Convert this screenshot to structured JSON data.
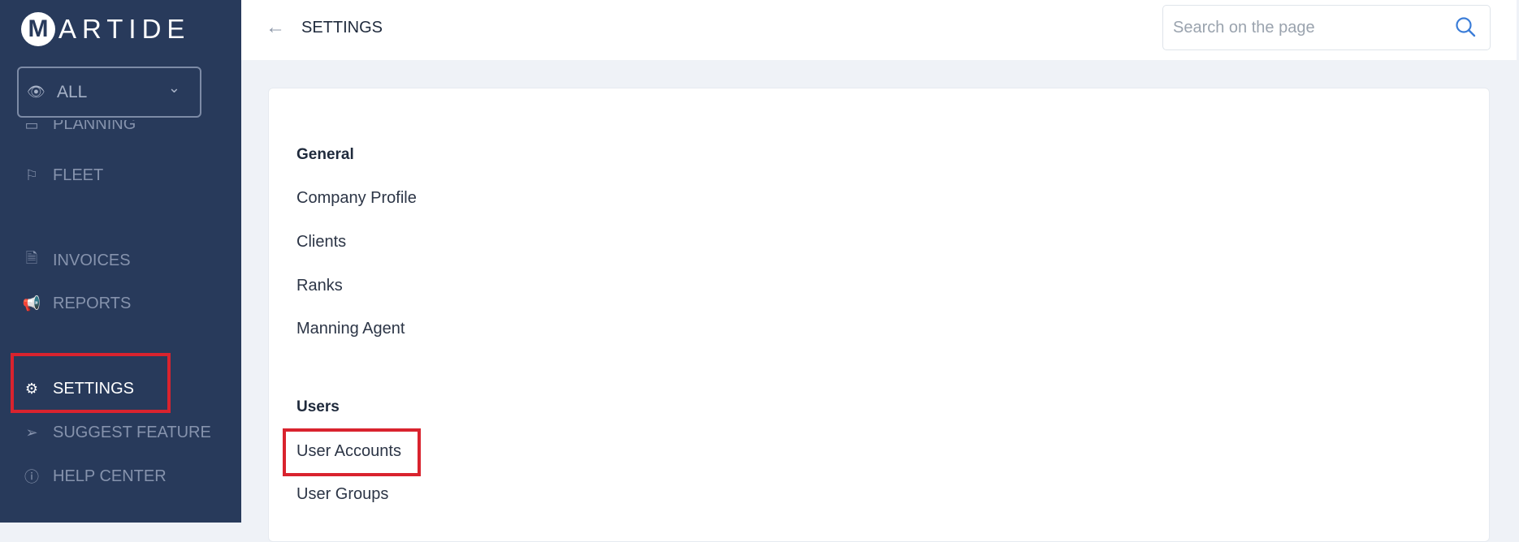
{
  "logo": {
    "mark": "M",
    "text": "ARTIDE"
  },
  "scope": {
    "value": "ALL",
    "icon": "eye-icon"
  },
  "sidebar": {
    "items": [
      {
        "label": "PLANNING",
        "icon": "calendar-icon"
      },
      {
        "label": "FLEET",
        "icon": "flag-icon"
      },
      {
        "label": "INVOICES",
        "icon": "document-icon"
      },
      {
        "label": "REPORTS",
        "icon": "megaphone-icon"
      },
      {
        "label": "SETTINGS",
        "icon": "gear-icon",
        "active": true
      },
      {
        "label": "SUGGEST FEATURE",
        "icon": "send-icon"
      },
      {
        "label": "HELP CENTER",
        "icon": "help-circle-icon"
      }
    ]
  },
  "header": {
    "title": "SETTINGS",
    "search_placeholder": "Search on the page"
  },
  "settings": {
    "sections": [
      {
        "title": "General",
        "items": [
          "Company Profile",
          "Clients",
          "Ranks",
          "Manning Agent"
        ]
      },
      {
        "title": "Users",
        "items": [
          "User Accounts",
          "User Groups"
        ]
      }
    ]
  },
  "colors": {
    "sidebar": "#283a5b",
    "highlight": "#d9232e",
    "accent": "#3b7dd8"
  }
}
